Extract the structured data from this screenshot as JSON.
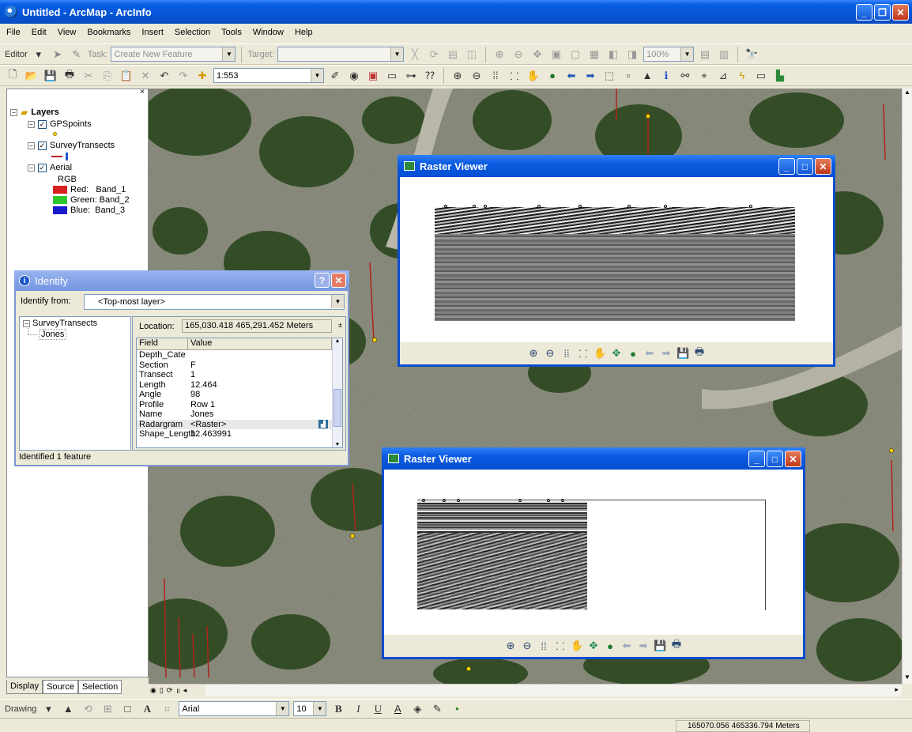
{
  "window": {
    "title": "Untitled - ArcMap - ArcInfo"
  },
  "menu": [
    "File",
    "Edit",
    "View",
    "Bookmarks",
    "Insert",
    "Selection",
    "Tools",
    "Window",
    "Help"
  ],
  "editor_toolbar": {
    "editor_label": "Editor",
    "task_label": "Task:",
    "task_value": "Create New Feature",
    "target_label": "Target:",
    "target_value": "",
    "zoom_value": "100%"
  },
  "standard_toolbar": {
    "scale_value": "1:553"
  },
  "toc": {
    "root": "Layers",
    "layers": [
      {
        "name": "GPSpoints",
        "checked": true
      },
      {
        "name": "SurveyTransects",
        "checked": true
      },
      {
        "name": "Aerial",
        "checked": true
      }
    ],
    "aerial_legend": {
      "heading": "RGB",
      "bands": [
        {
          "label": "Red:   Band_1",
          "color": "#d82020"
        },
        {
          "label": "Green: Band_2",
          "color": "#2ec82e"
        },
        {
          "label": "Blue:  Band_3",
          "color": "#1a1acc"
        }
      ]
    },
    "tabs": [
      "Display",
      "Source",
      "Selection"
    ]
  },
  "identify": {
    "title": "Identify",
    "from_label": "Identify from:",
    "from_value": "<Top-most layer>",
    "tree_root": "SurveyTransects",
    "tree_child": "Jones",
    "location_label": "Location:",
    "location_value": "165,030.418  465,291.452 Meters",
    "columns": [
      "Field",
      "Value"
    ],
    "rows": [
      {
        "field": "Depth_Cate",
        "value": ""
      },
      {
        "field": "Section",
        "value": "F"
      },
      {
        "field": "Transect",
        "value": "1"
      },
      {
        "field": "Length",
        "value": "12.464"
      },
      {
        "field": "Angle",
        "value": "98"
      },
      {
        "field": "Profile",
        "value": "Row 1"
      },
      {
        "field": "Name",
        "value": "Jones"
      },
      {
        "field": "Radargram",
        "value": "<Raster>"
      },
      {
        "field": "Shape_Length",
        "value": "12.463991"
      }
    ],
    "status": "Identified 1 feature"
  },
  "raster_viewer_1": {
    "title": "Raster Viewer"
  },
  "raster_viewer_2": {
    "title": "Raster Viewer"
  },
  "drawing_toolbar": {
    "drawing_label": "Drawing",
    "font_value": "Arial",
    "size_value": "10",
    "bold": "B",
    "italic": "I",
    "underline": "U"
  },
  "status": {
    "coordinates": "165070.056  465336.794 Meters"
  }
}
